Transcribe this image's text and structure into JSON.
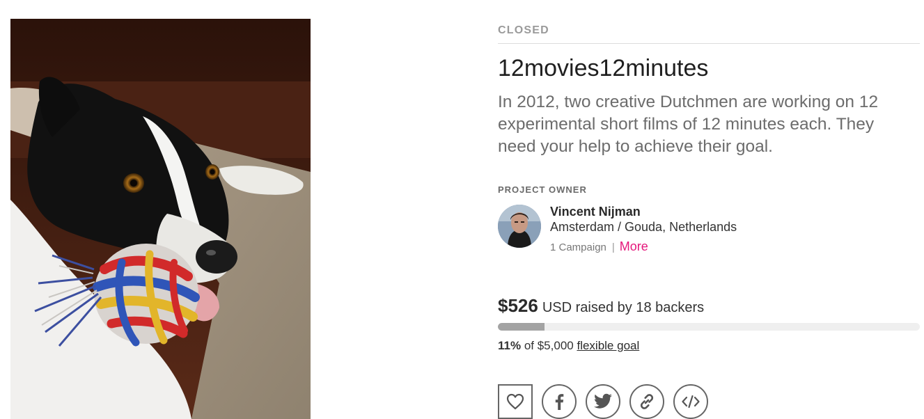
{
  "campaign": {
    "image_alt": "Black and white dog holding a colorful rope toy",
    "status": "CLOSED",
    "title": "12movies12minutes",
    "tagline": "In 2012, two creative Dutchmen are working on 12 experimental short films of 12 minutes each. They need your help to achieve their goal."
  },
  "owner": {
    "section_label": "PROJECT OWNER",
    "name": "Vincent Nijman",
    "location": "Amsterdam / Gouda, Netherlands",
    "campaigns": "1 Campaign",
    "separator": "|",
    "more_label": "More"
  },
  "funding": {
    "amount": "$526",
    "raised_text": "USD raised by 18 backers",
    "percent": "11%",
    "progress_fraction": 0.11,
    "goal_text": "of $5,000",
    "goal_type": "flexible goal"
  },
  "actions": [
    {
      "name": "follow",
      "icon": "heart-icon"
    },
    {
      "name": "share-facebook",
      "icon": "facebook-icon"
    },
    {
      "name": "share-twitter",
      "icon": "twitter-icon"
    },
    {
      "name": "copy-link",
      "icon": "link-icon"
    },
    {
      "name": "embed",
      "icon": "embed-icon"
    }
  ],
  "colors": {
    "accent_link": "#e5177b",
    "status_gray": "#9a9a9a",
    "progress_fill": "#a3a3a3",
    "progress_track": "#efefef"
  }
}
